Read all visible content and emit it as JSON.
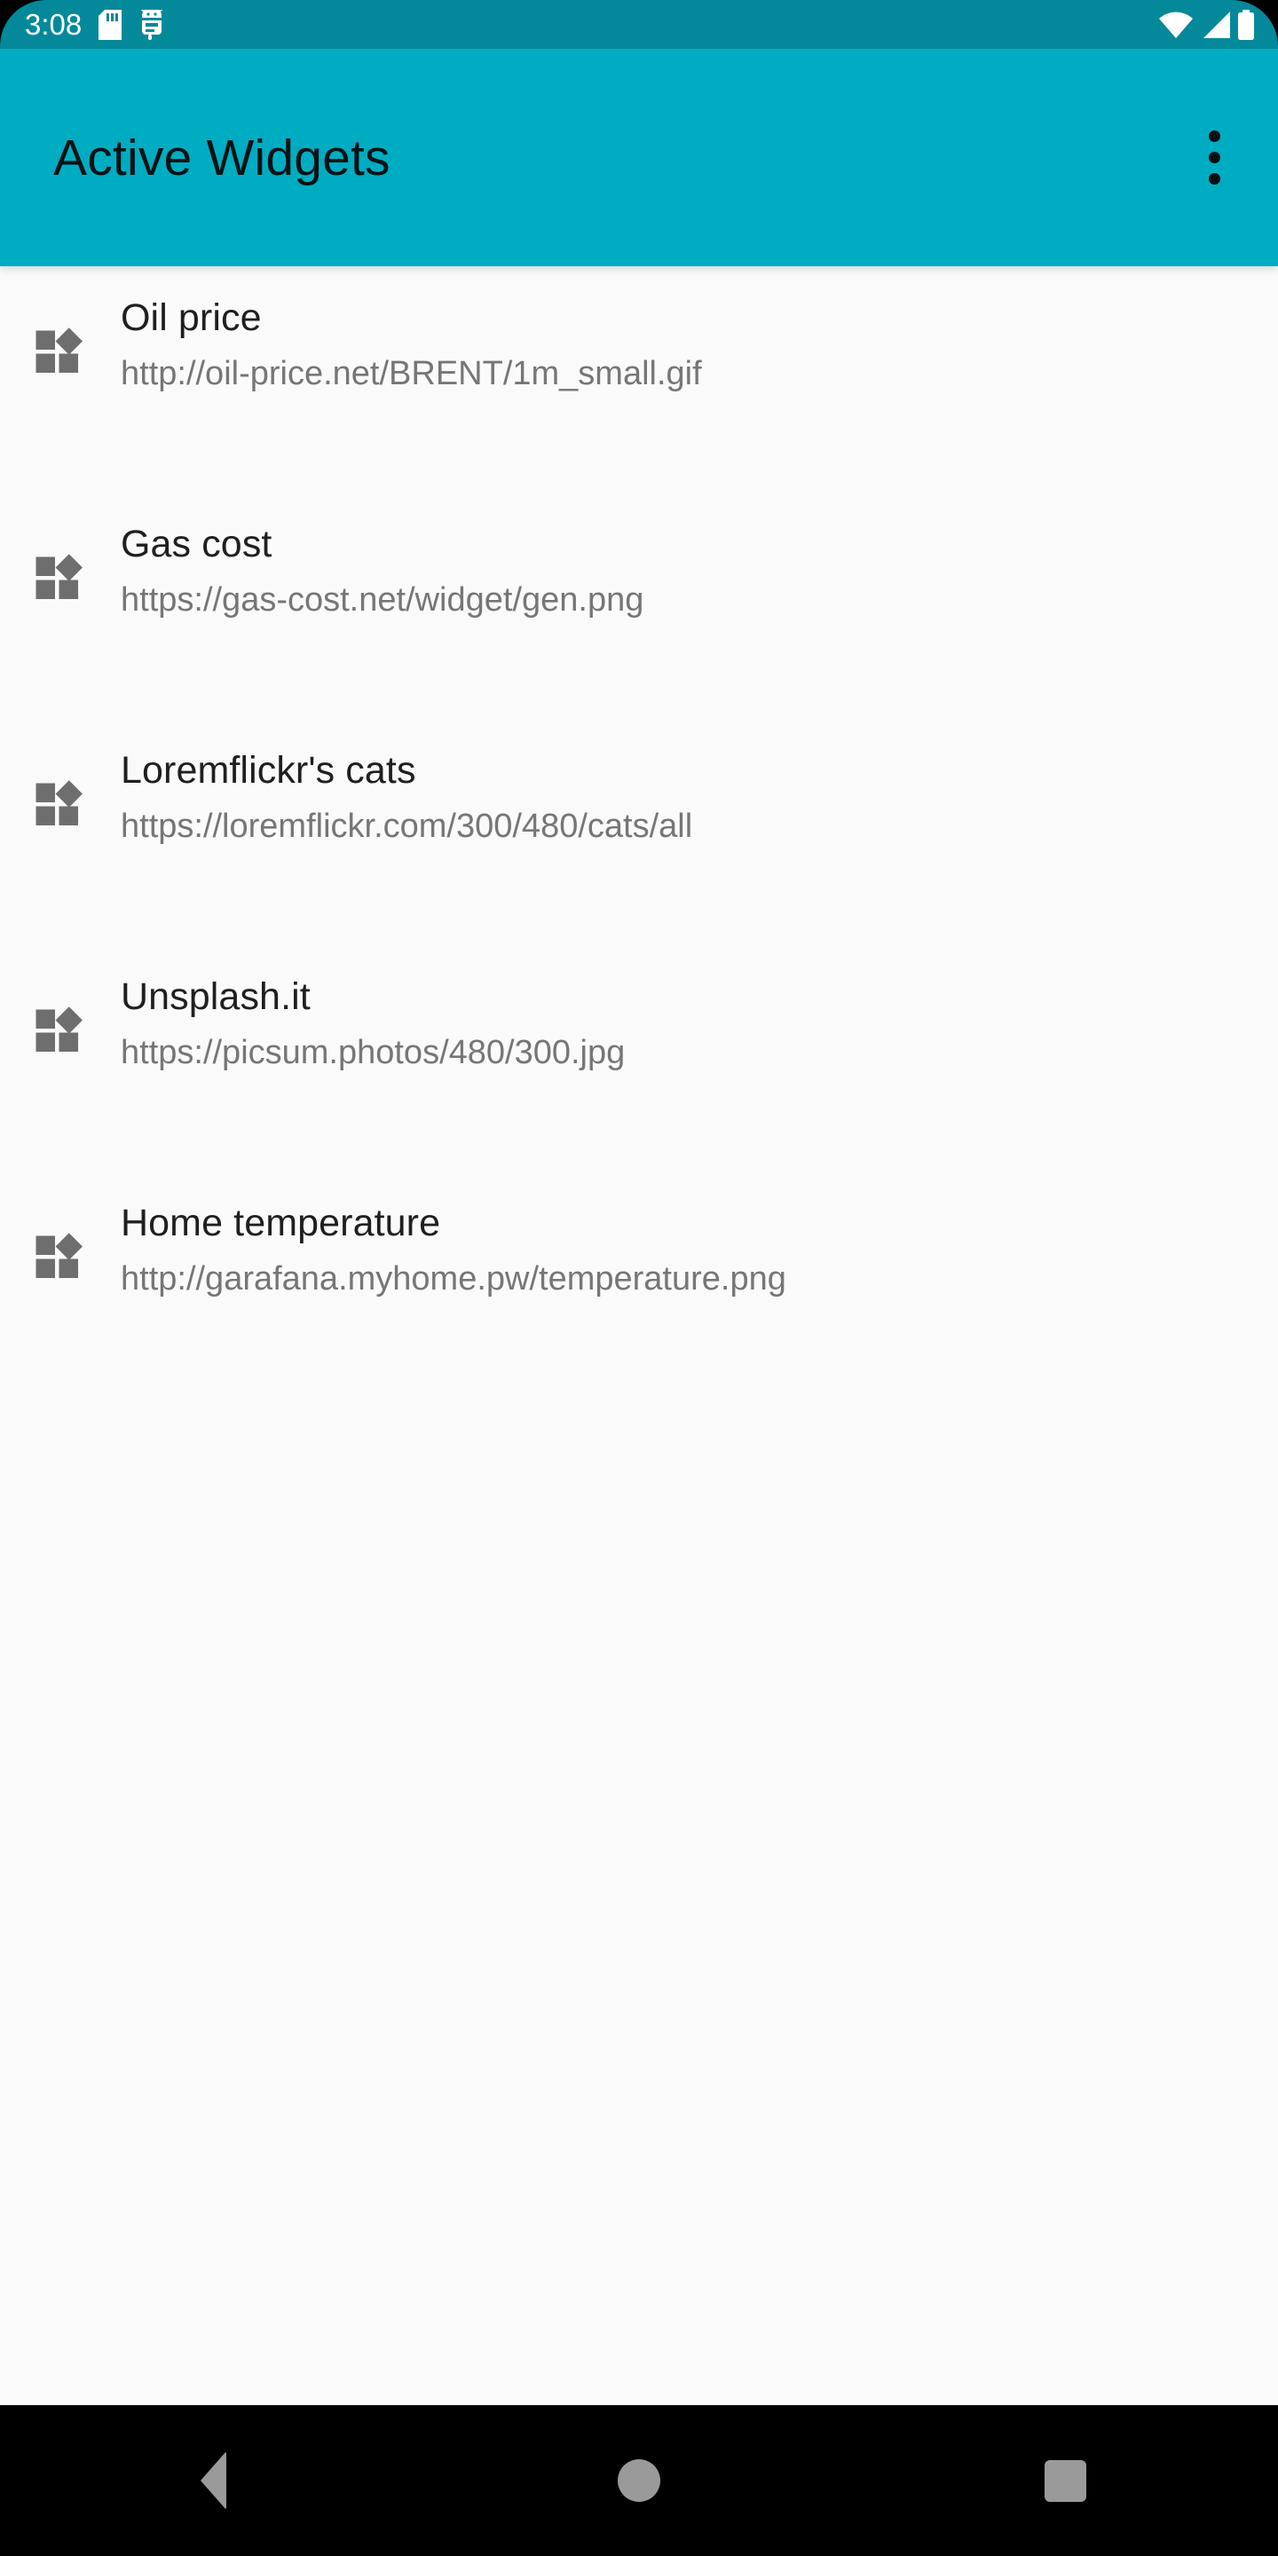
{
  "status_bar": {
    "time": "3:08",
    "icons": [
      "sd-card-icon",
      "android-debug-icon"
    ],
    "right_icons": [
      "wifi-icon",
      "cell-signal-icon",
      "battery-icon"
    ],
    "background_color": "#04899A"
  },
  "app_bar": {
    "title": "Active Widgets",
    "overflow_label": "More options",
    "background_color": "#00ACC1",
    "title_color": "#081214"
  },
  "list": {
    "item_icon_name": "widgets-icon",
    "title_color": "#1F1F1F",
    "url_color": "#767676",
    "items": [
      {
        "title": "Oil price",
        "url": "http://oil-price.net/BRENT/1m_small.gif"
      },
      {
        "title": "Gas cost",
        "url": "https://gas-cost.net/widget/gen.png"
      },
      {
        "title": "Loremflickr's cats",
        "url": "https://loremflickr.com/300/480/cats/all"
      },
      {
        "title": "Unsplash.it",
        "url": "https://picsum.photos/480/300.jpg"
      },
      {
        "title": "Home temperature",
        "url": "http://garafana.myhome.pw/temperature.png"
      }
    ]
  },
  "nav_bar": {
    "back_label": "Back",
    "home_label": "Home",
    "recents_label": "Recents",
    "background_color": "#000000",
    "icon_color": "#9A9A9A"
  }
}
